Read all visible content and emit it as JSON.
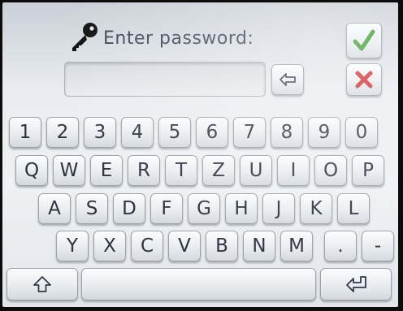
{
  "prompt": "Enter password:",
  "password_value": "",
  "keyboard": {
    "rows": [
      [
        "1",
        "2",
        "3",
        "4",
        "5",
        "6",
        "7",
        "8",
        "9",
        "0"
      ],
      [
        "Q",
        "W",
        "E",
        "R",
        "T",
        "Z",
        "U",
        "I",
        "O",
        "P"
      ],
      [
        "A",
        "S",
        "D",
        "F",
        "G",
        "H",
        "J",
        "K",
        "L"
      ],
      [
        "Y",
        "X",
        "C",
        "V",
        "B",
        "N",
        "M",
        ".",
        "-"
      ]
    ]
  },
  "icons": {
    "key": "key-icon",
    "backspace": "backspace-arrow-icon",
    "ok": "checkmark-icon",
    "cancel": "cross-icon",
    "shift": "shift-arrow-icon",
    "enter": "enter-return-icon"
  },
  "colors": {
    "ok": "#3c9a2e",
    "cancel": "#d12b2b"
  }
}
